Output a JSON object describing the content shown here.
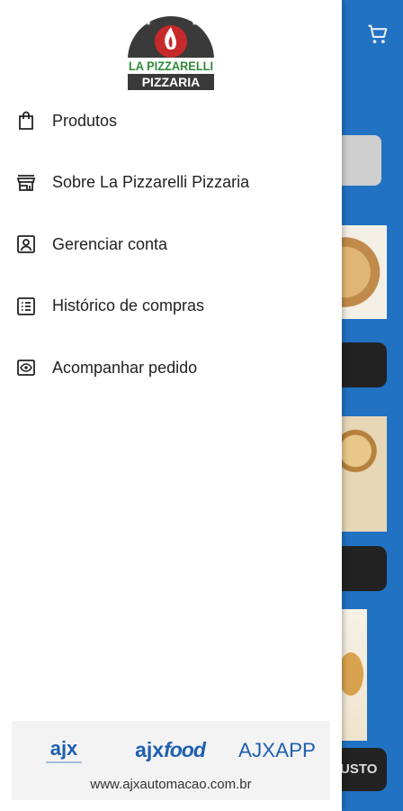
{
  "background": {
    "visible_button_text": "USTO"
  },
  "drawer": {
    "logo": {
      "line1": "LA PIZZARELLI",
      "line2": "PIZZARIA"
    },
    "menu": [
      {
        "label": "Produtos",
        "icon": "shopping-bag-icon"
      },
      {
        "label": "Sobre La Pizzarelli Pizzaria",
        "icon": "storefront-icon"
      },
      {
        "label": "Gerenciar conta",
        "icon": "account-box-icon"
      },
      {
        "label": "Histórico de compras",
        "icon": "list-icon"
      },
      {
        "label": "Acompanhar pedido",
        "icon": "eye-icon"
      }
    ],
    "footer": {
      "brand1": "ajx",
      "brand2_a": "ajx",
      "brand2_b": "food",
      "brand3": "AJXAPP",
      "url": "www.ajxautomacao.com.br"
    }
  },
  "colors": {
    "app_blue": "#2172c2",
    "logo_dark": "#3a3a3a",
    "logo_red": "#c62a2a",
    "logo_green": "#2f8a3b",
    "brand_blue": "#1e5fb0"
  }
}
